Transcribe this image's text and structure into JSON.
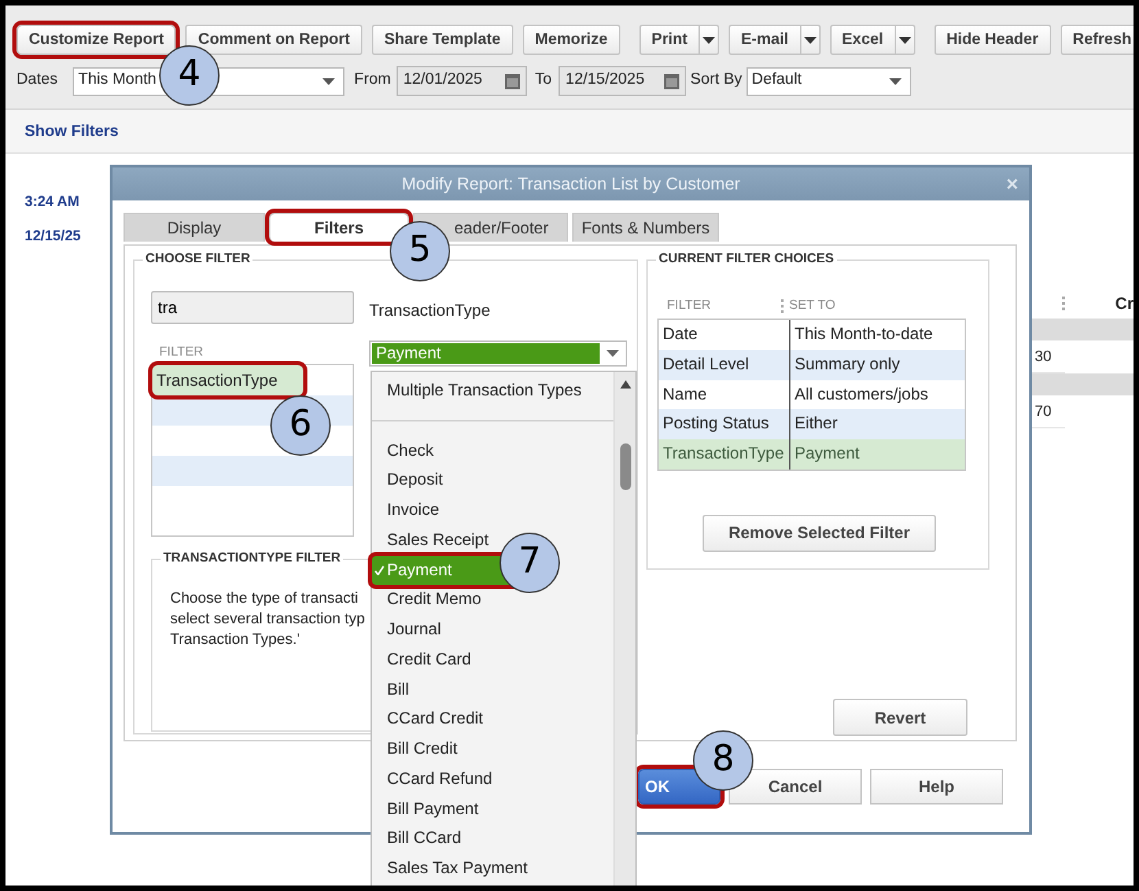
{
  "toolbar": {
    "buttons": [
      {
        "label": "Customize Report",
        "kind": "button",
        "highlighted": true,
        "callout": "4"
      },
      {
        "label": "Comment on Report",
        "kind": "button",
        "highlighted": false
      },
      {
        "label": "Share Template",
        "kind": "button",
        "highlighted": false
      },
      {
        "label": "Memorize",
        "kind": "button",
        "highlighted": false
      },
      {
        "label": "Print",
        "kind": "split",
        "highlighted": false
      },
      {
        "label": "E-mail",
        "kind": "split",
        "highlighted": false
      },
      {
        "label": "Excel",
        "kind": "split",
        "highlighted": false
      },
      {
        "label": "Hide Header",
        "kind": "button",
        "highlighted": false
      },
      {
        "label": "Refresh",
        "kind": "button",
        "highlighted": false
      }
    ]
  },
  "filter_bar": {
    "dates_label": "Dates",
    "dates_value": "This Month",
    "from_label": "From",
    "from_value": "12/01/2025",
    "to_label": "To",
    "to_value": "12/15/2025",
    "sort_label": "Sort By",
    "sort_value": "Default"
  },
  "show_filters": "Show Filters",
  "report": {
    "time": "3:24 AM",
    "date": "12/15/25",
    "column_header": "Cr",
    "rows": [
      "30",
      "70"
    ]
  },
  "dialog": {
    "title": "Modify Report: Transaction List by Customer",
    "close": "×",
    "tabs": [
      {
        "label": "Display",
        "selected": false,
        "highlighted": false
      },
      {
        "label": "Filters",
        "selected": true,
        "highlighted": true,
        "callout": "5"
      },
      {
        "label": "eader/Footer",
        "selected": false,
        "highlighted": false
      },
      {
        "label": "Fonts & Numbers",
        "selected": false,
        "highlighted": false
      }
    ],
    "choose_filter": {
      "heading": "CHOOSE FILTER",
      "search_value": "tra",
      "list_heading": "FILTER",
      "items": [
        {
          "label": "TransactionType",
          "selected": true,
          "highlighted": true,
          "callout": "6"
        }
      ],
      "filter_name": "TransactionType",
      "filter_value": "Payment",
      "dropdown": [
        {
          "kind": "option",
          "label": "Multiple Transaction Types",
          "selected": false,
          "highlighted": false
        },
        {
          "kind": "separator"
        },
        {
          "kind": "option",
          "label": "Check",
          "selected": false,
          "highlighted": false
        },
        {
          "kind": "option",
          "label": "Deposit",
          "selected": false,
          "highlighted": false
        },
        {
          "kind": "option",
          "label": "Invoice",
          "selected": false,
          "highlighted": false
        },
        {
          "kind": "option",
          "label": "Sales Receipt",
          "selected": false,
          "highlighted": false
        },
        {
          "kind": "option",
          "label": "Payment",
          "selected": true,
          "highlighted": true,
          "callout": "7"
        },
        {
          "kind": "option",
          "label": "Credit Memo",
          "selected": false,
          "highlighted": false
        },
        {
          "kind": "option",
          "label": "Journal",
          "selected": false,
          "highlighted": false
        },
        {
          "kind": "option",
          "label": "Credit Card",
          "selected": false,
          "highlighted": false
        },
        {
          "kind": "option",
          "label": "Bill",
          "selected": false,
          "highlighted": false
        },
        {
          "kind": "option",
          "label": "CCard Credit",
          "selected": false,
          "highlighted": false
        },
        {
          "kind": "option",
          "label": "Bill Credit",
          "selected": false,
          "highlighted": false
        },
        {
          "kind": "option",
          "label": "CCard Refund",
          "selected": false,
          "highlighted": false
        },
        {
          "kind": "option",
          "label": "Bill Payment",
          "selected": false,
          "highlighted": false
        },
        {
          "kind": "option",
          "label": "Bill CCard",
          "selected": false,
          "highlighted": false
        },
        {
          "kind": "option",
          "label": "Sales Tax Payment",
          "selected": false,
          "highlighted": false
        }
      ],
      "description_heading": "TRANSACTIONTYPE FILTER",
      "description_lines": [
        "Choose the type of transacti",
        "select several transaction typ",
        "Transaction Types.'"
      ]
    },
    "current_filters": {
      "heading": "CURRENT FILTER CHOICES",
      "columns": [
        "FILTER",
        "SET TO"
      ],
      "rows": [
        {
          "filter": "Date",
          "set_to": "This Month-to-date",
          "selected": false
        },
        {
          "filter": "Detail Level",
          "set_to": "Summary only",
          "selected": false
        },
        {
          "filter": "Name",
          "set_to": "All customers/jobs",
          "selected": false
        },
        {
          "filter": "Posting Status",
          "set_to": "Either",
          "selected": false
        },
        {
          "filter": "TransactionType",
          "set_to": "Payment",
          "selected": true
        }
      ],
      "remove_button": "Remove Selected Filter"
    },
    "revert_button": "Revert",
    "buttons": [
      {
        "label": "OK",
        "kind": "primary",
        "highlighted": true,
        "callout": "8"
      },
      {
        "label": "Cancel",
        "kind": "default",
        "highlighted": false
      },
      {
        "label": "Help",
        "kind": "default",
        "highlighted": false
      }
    ]
  }
}
